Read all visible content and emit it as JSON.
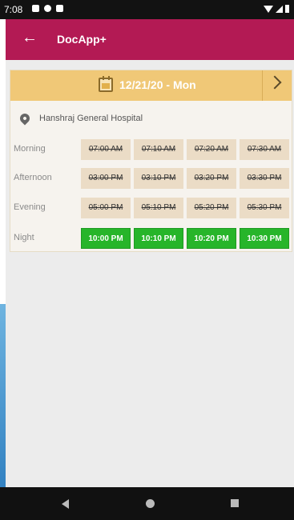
{
  "status_bar": {
    "time": "7:08"
  },
  "app_bar": {
    "back_icon": "arrow-left-icon",
    "title": "DocApp+"
  },
  "date_selector": {
    "date_label": "12/21/20 - Mon",
    "calendar_icon": "calendar-icon",
    "next_icon": "chevron-right-icon"
  },
  "hospital": {
    "icon": "location-pin-icon",
    "name": "Hanshraj General Hospital"
  },
  "colors": {
    "app_bar": "#b31a54",
    "date_bar": "#f0c877",
    "booked_slot": "#ebdcc6",
    "available_slot": "#27b52a"
  },
  "sessions": [
    {
      "label": "Morning",
      "slots": [
        "07:00 AM",
        "07:10 AM",
        "07:20 AM",
        "07:30 AM"
      ],
      "available": [
        false,
        false,
        false,
        false
      ]
    },
    {
      "label": "Afternoon",
      "slots": [
        "03:00 PM",
        "03:10 PM",
        "03:20 PM",
        "03:30 PM"
      ],
      "available": [
        false,
        false,
        false,
        false
      ]
    },
    {
      "label": "Evening",
      "slots": [
        "05:00 PM",
        "05:10 PM",
        "05:20 PM",
        "05:30 PM"
      ],
      "available": [
        false,
        false,
        false,
        false
      ]
    },
    {
      "label": "Night",
      "slots": [
        "10:00 PM",
        "10:10 PM",
        "10:20 PM",
        "10:30 PM"
      ],
      "available": [
        true,
        true,
        true,
        true
      ]
    }
  ],
  "nav_bar": {
    "back": "nav-back-icon",
    "home": "nav-home-icon",
    "recents": "nav-recents-icon"
  }
}
